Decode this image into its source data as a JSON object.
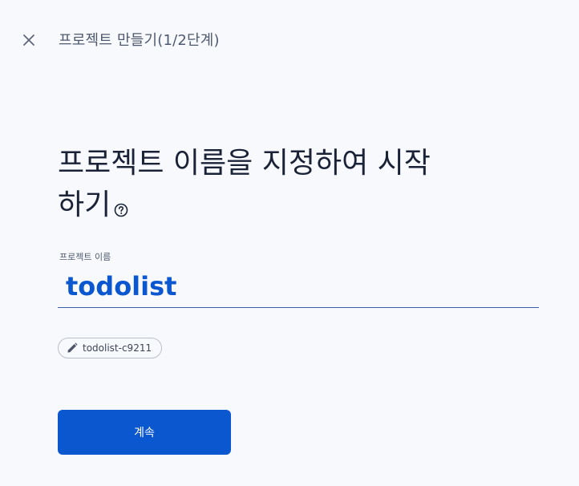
{
  "header": {
    "title": "프로젝트 만들기(1/2단계)",
    "close_icon": "close-icon"
  },
  "main": {
    "heading": "프로젝트 이름을 지정하여 시작하기",
    "help_icon": "help-circle-icon",
    "field_label": "프로젝트 이름",
    "project_name_value": "todolist",
    "project_id_chip": "todolist-c9211",
    "edit_icon": "pencil-icon",
    "continue_label": "계속"
  },
  "colors": {
    "accent": "#0b57d0",
    "background": "#f8f9fd",
    "text": "#1a2238"
  }
}
